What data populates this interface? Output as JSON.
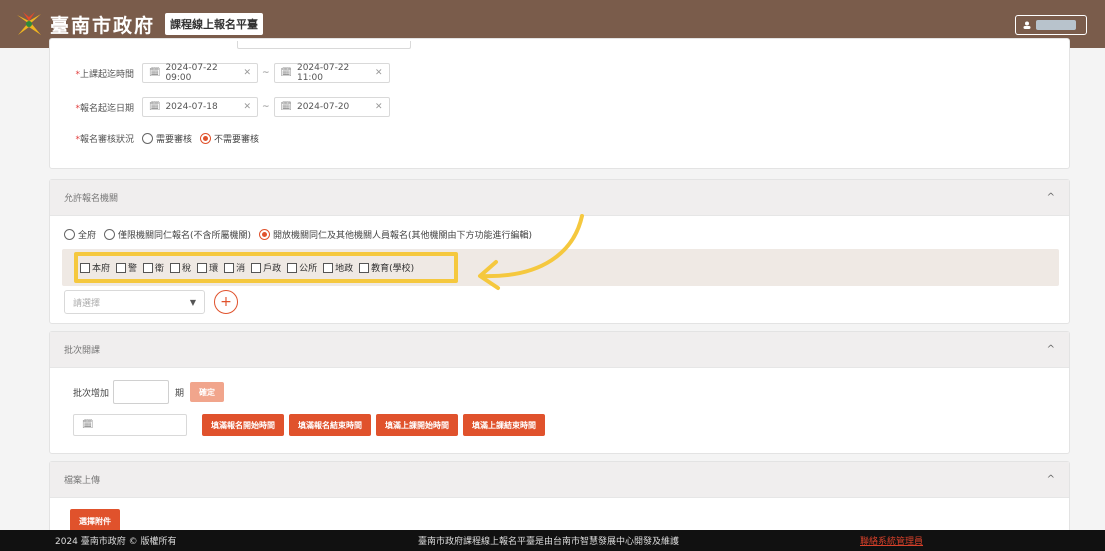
{
  "header": {
    "city_name": "臺南市政府",
    "platform_title": "課程線上報名平臺"
  },
  "course_form": {
    "class_time_label": "上課起迄時間",
    "class_start": "2024-07-22 09:00",
    "class_end": "2024-07-22 11:00",
    "signup_date_label": "報名起迄日期",
    "signup_start": "2024-07-18",
    "signup_end": "2024-07-20",
    "review_label": "報名審核狀況",
    "review_options": [
      "需要審核",
      "不需要審核"
    ],
    "review_selected": "不需要審核",
    "tilde": "~"
  },
  "agencies": {
    "title": "允許報名機關",
    "scope_options": [
      "全府",
      "僅限機關同仁報名(不含所屬機關)",
      "開放機關同仁及其他機關人員報名(其他機關由下方功能進行編輯)"
    ],
    "scope_selected": "開放機關同仁及其他機關人員報名(其他機關由下方功能進行編輯)",
    "checkboxes": [
      "本府",
      "警",
      "衛",
      "稅",
      "環",
      "消",
      "戶政",
      "公所",
      "地政",
      "教育(學校)"
    ],
    "select_placeholder": "請選擇"
  },
  "batch": {
    "title": "批次開課",
    "add_label": "批次增加",
    "unit": "期",
    "confirm": "確定",
    "buttons": [
      "填滿報名開始時間",
      "填滿報名結束時間",
      "填滿上課開始時間",
      "填滿上課結束時間"
    ]
  },
  "upload": {
    "title": "檔案上傳",
    "select_file": "選擇附件"
  },
  "footer": {
    "copyright": "2024 臺南市政府 © 版權所有",
    "credit": "臺南市政府課程線上報名平臺是由台南市智慧發展中心開發及維護",
    "contact": "聯絡系統管理員"
  },
  "colors": {
    "header": "#7a5c4b",
    "accent": "#e0522c",
    "highlight": "#f5c83e"
  }
}
